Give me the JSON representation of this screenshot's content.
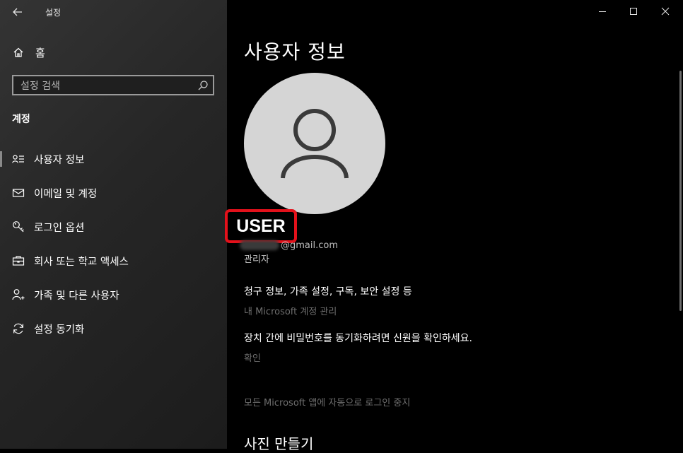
{
  "window": {
    "title": "설정"
  },
  "sidebar": {
    "home_label": "홈",
    "search_placeholder": "설정 검색",
    "section_title": "계정",
    "items": [
      {
        "label": "사용자 정보",
        "icon": "user-info-icon",
        "active": true
      },
      {
        "label": "이메일 및 계정",
        "icon": "mail-icon"
      },
      {
        "label": "로그인 옵션",
        "icon": "key-icon"
      },
      {
        "label": "회사 또는 학교 액세스",
        "icon": "briefcase-icon"
      },
      {
        "label": "가족 및 다른 사용자",
        "icon": "person-add-icon"
      },
      {
        "label": "설정 동기화",
        "icon": "sync-icon"
      }
    ]
  },
  "main": {
    "title": "사용자 정보",
    "user_name": "USER",
    "email_visible": "@gmail.com",
    "role": "관리자",
    "billing_desc": "청구 정보, 가족 설정, 구독, 보안 설정 등",
    "manage_link": "내 Microsoft 계정 관리",
    "sync_desc": "장치 간에 비밀번호를 동기화하려면 신원을 확인하세요.",
    "verify_link": "확인",
    "stop_link": "모든 Microsoft 앱에 자동으로 로그인 중지",
    "photo_section_title": "사진 만들기"
  },
  "colors": {
    "highlight_border": "#e3111b",
    "avatar_bg": "#d5d5d5",
    "link_disabled": "#6e6e6e"
  }
}
